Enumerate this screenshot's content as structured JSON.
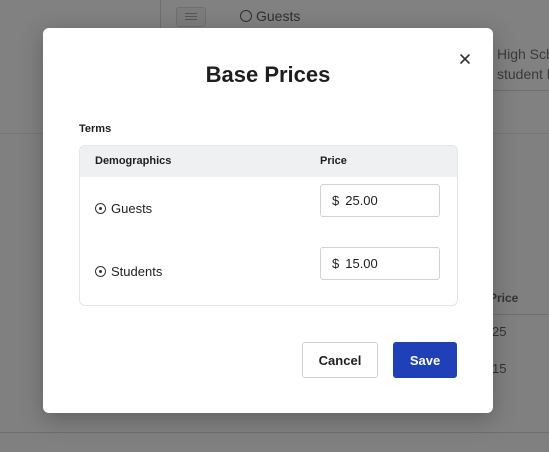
{
  "background": {
    "guests_label": "Guests",
    "right_text_line1": "High Sch",
    "right_text_line2": "student l",
    "price_header": "Price",
    "row1_value": "25",
    "row2_value": "15"
  },
  "modal": {
    "title": "Base Prices",
    "close_icon": "close-icon",
    "section_label": "Terms",
    "table": {
      "columns": [
        "Demographics",
        "Price"
      ],
      "rows": [
        {
          "label": "Guests",
          "currency": "$",
          "value": "25.00"
        },
        {
          "label": "Students",
          "currency": "$",
          "value": "15.00"
        }
      ]
    },
    "cancel_label": "Cancel",
    "save_label": "Save"
  },
  "colors": {
    "primary": "#1f40b8",
    "overlay": "#808080"
  }
}
